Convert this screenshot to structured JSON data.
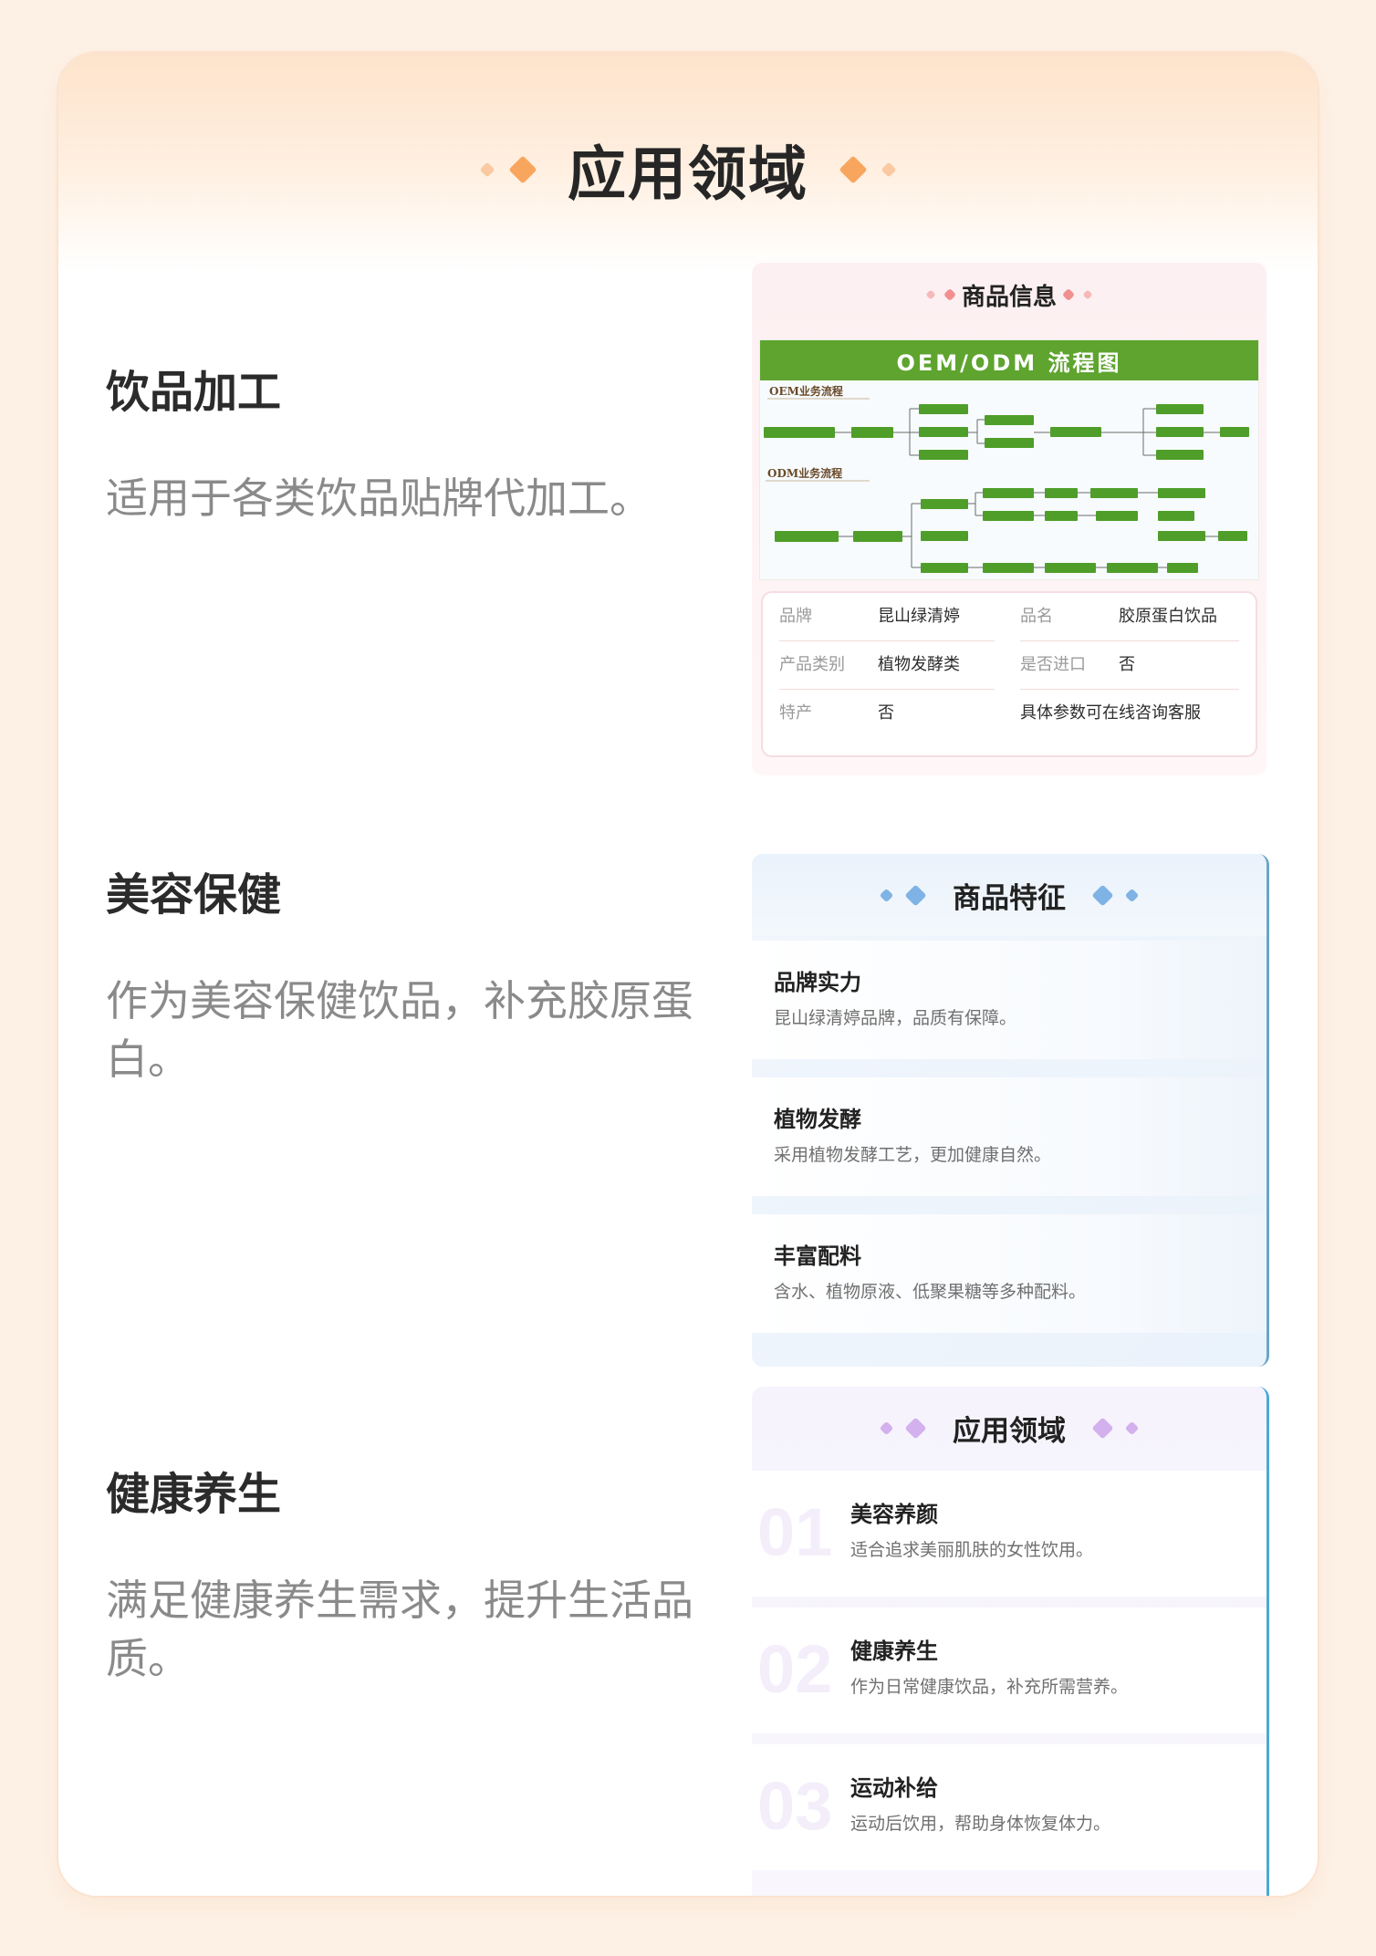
{
  "page": {
    "title": "应用领域"
  },
  "left_items": [
    {
      "heading": "饮品加工",
      "text": "适用于各类饮品贴牌代加工。"
    },
    {
      "heading": "美容保健",
      "text": "作为美容保健饮品，补充胶原蛋白。"
    },
    {
      "heading": "健康养生",
      "text": "满足健康养生需求，提升生活品质。"
    }
  ],
  "info_panel": {
    "title": "商品信息",
    "flow_title": "OEM/ODM 流程图",
    "oem_label": "OEM业务流程",
    "odm_label": "ODM业务流程",
    "specs": [
      {
        "label": "品牌",
        "value": "昆山绿清婷"
      },
      {
        "label": "品名",
        "value": "胶原蛋白饮品"
      },
      {
        "label": "产品类别",
        "value": "植物发酵类"
      },
      {
        "label": "是否进口",
        "value": "否"
      },
      {
        "label": "特产",
        "value": "否"
      },
      {
        "note": "具体参数可在线咨询客服"
      }
    ]
  },
  "features_panel": {
    "title": "商品特征",
    "items": [
      {
        "title": "品牌实力",
        "desc": "昆山绿清婷品牌，品质有保障。"
      },
      {
        "title": "植物发酵",
        "desc": "采用植物发酵工艺，更加健康自然。"
      },
      {
        "title": "丰富配料",
        "desc": "含水、植物原液、低聚果糖等多种配料。"
      }
    ]
  },
  "apps_panel": {
    "title": "应用领域",
    "items": [
      {
        "num": "01",
        "title": "美容养颜",
        "desc": "适合追求美丽肌肤的女性饮用。"
      },
      {
        "num": "02",
        "title": "健康养生",
        "desc": "作为日常健康饮品，补充所需营养。"
      },
      {
        "num": "03",
        "title": "运动补给",
        "desc": "运动后饮用，帮助身体恢复体力。"
      }
    ]
  },
  "colors": {
    "background": "#fdf1e6",
    "accent_orange": "#f8a65e",
    "flow_green": "#5ea42f",
    "accent_pink": "#f19090",
    "accent_blue": "#7fb3e6",
    "accent_purple": "#d3b0ee"
  }
}
